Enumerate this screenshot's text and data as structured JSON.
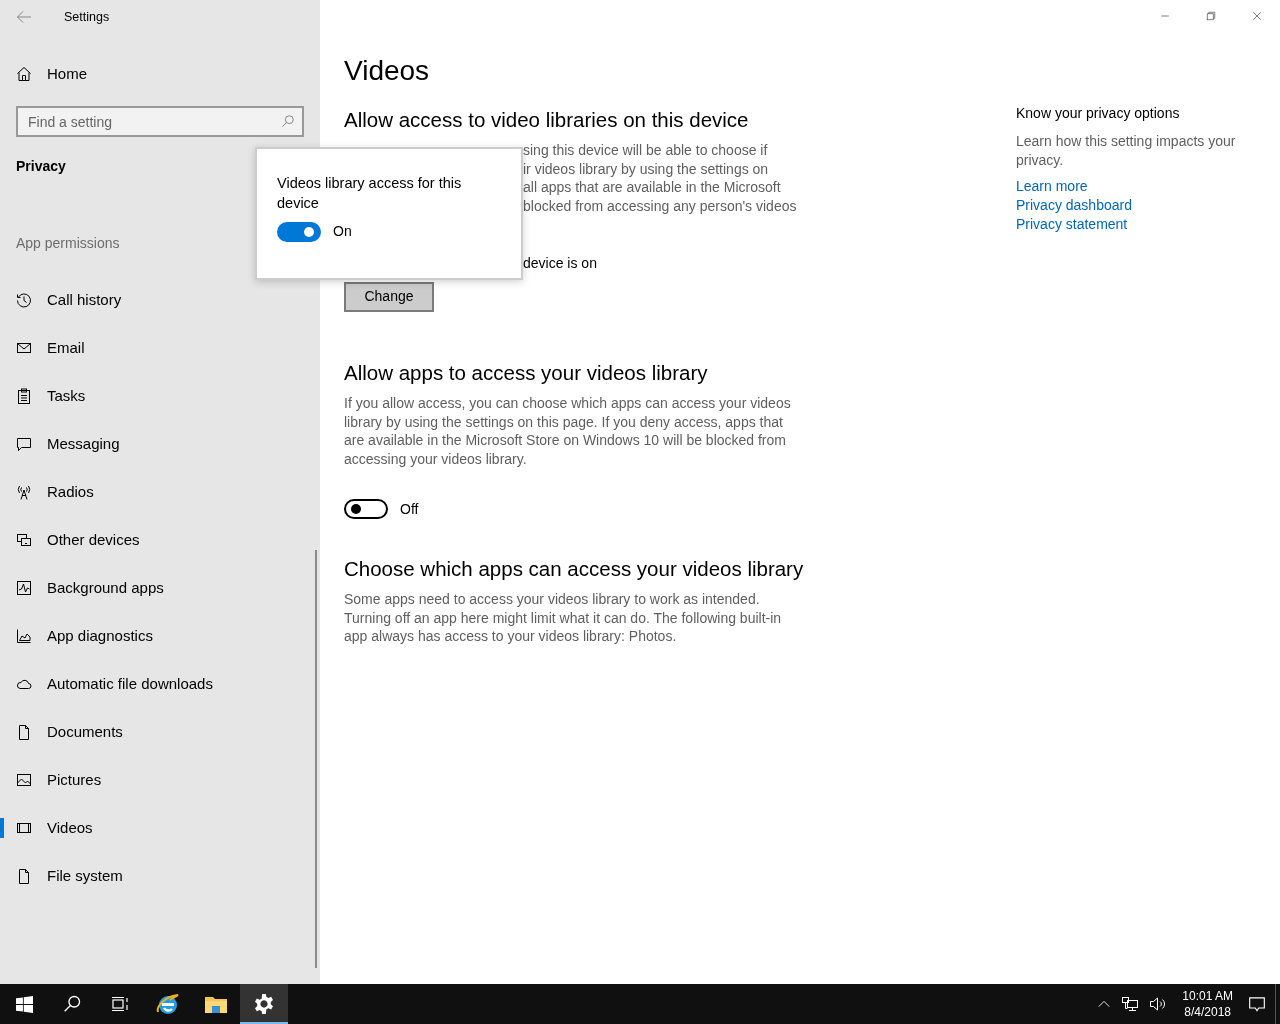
{
  "window": {
    "title": "Settings"
  },
  "sidebar": {
    "home": "Home",
    "search": {
      "placeholder": "Find a setting"
    },
    "section": "Privacy",
    "group": "App permissions",
    "items": [
      {
        "label": "Call history",
        "selected": false
      },
      {
        "label": "Email",
        "selected": false
      },
      {
        "label": "Tasks",
        "selected": false
      },
      {
        "label": "Messaging",
        "selected": false
      },
      {
        "label": "Radios",
        "selected": false
      },
      {
        "label": "Other devices",
        "selected": false
      },
      {
        "label": "Background apps",
        "selected": false
      },
      {
        "label": "App diagnostics",
        "selected": false
      },
      {
        "label": "Automatic file downloads",
        "selected": false
      },
      {
        "label": "Documents",
        "selected": false
      },
      {
        "label": "Pictures",
        "selected": false
      },
      {
        "label": "Videos",
        "selected": true
      },
      {
        "label": "File system",
        "selected": false
      }
    ]
  },
  "main": {
    "title": "Videos",
    "sections": [
      {
        "heading": "Allow access to video libraries on this device",
        "description_fragments": [
          "sing this device will be able to choose if",
          "ir videos library by using the settings on",
          "all apps that are available in the Microsoft",
          "blocked from accessing any person's videos"
        ],
        "status": "device is on",
        "button": "Change"
      },
      {
        "heading": "Allow apps to access your videos library",
        "description": "If you allow access, you can choose which apps can access your videos library by using the settings on this page. If you deny access, apps that are available in the Microsoft Store on Windows 10 will be blocked from accessing your videos library.",
        "toggle": {
          "on": false,
          "label": "Off"
        }
      },
      {
        "heading": "Choose which apps can access your videos library",
        "description": "Some apps need to access your videos library to work as intended. Turning off an app here might limit what it can do. The following built-in app always has access to your videos library: Photos."
      }
    ]
  },
  "popup": {
    "title": "Videos library access for this device",
    "toggle": {
      "on": true,
      "label": "On"
    }
  },
  "aside": {
    "heading": "Know your privacy options",
    "text": "Learn how this setting impacts your privacy.",
    "links": [
      "Learn more",
      "Privacy dashboard",
      "Privacy statement"
    ]
  },
  "taskbar": {
    "pinned": [
      {
        "selected": false
      },
      {
        "selected": false
      },
      {
        "selected": true
      }
    ],
    "time": "10:01 AM",
    "date": "8/4/2018"
  }
}
